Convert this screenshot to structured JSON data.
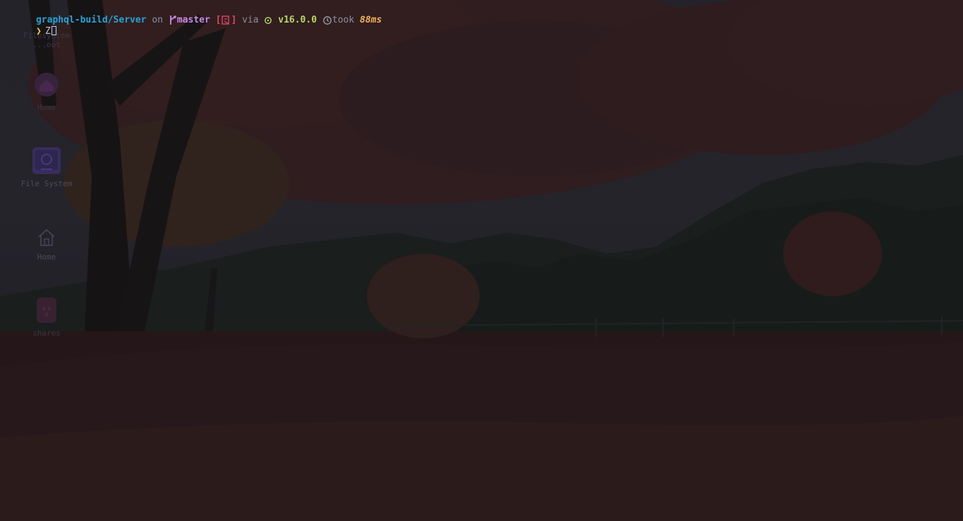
{
  "desktop": {
    "icons": [
      {
        "label": "Filesystem",
        "label2": "...oot",
        "icon": "hard-drive-icon"
      },
      {
        "label": "Home",
        "icon": "home-folder-icon"
      },
      {
        "label": "File System",
        "icon": "file-system-icon"
      },
      {
        "label": "Home",
        "icon": "home-icon"
      },
      {
        "label": "shares",
        "icon": "network-share-icon"
      }
    ]
  },
  "terminal": {
    "prompt": {
      "path": "graphql-build/Server",
      "on_word": " on ",
      "branch_icon": "git-branch-icon",
      "branch": "master",
      "status_open": " [",
      "status_icon": "git-status-icon",
      "status_close": "]",
      "via_word": " via ",
      "node_icon": "nodejs-icon",
      "node_version": " v16.0.0",
      "clock_icon": "clock-icon",
      "took_word": "took ",
      "duration": "88ms"
    },
    "input": {
      "chevron": "❯",
      "typed_text": "Z"
    }
  },
  "colors": {
    "path": "#27a3d6",
    "branch": "#c88be6",
    "status": "#e0466a",
    "node": "#b8d96a",
    "duration": "#f0b45a",
    "chevron": "#f0d23c"
  }
}
